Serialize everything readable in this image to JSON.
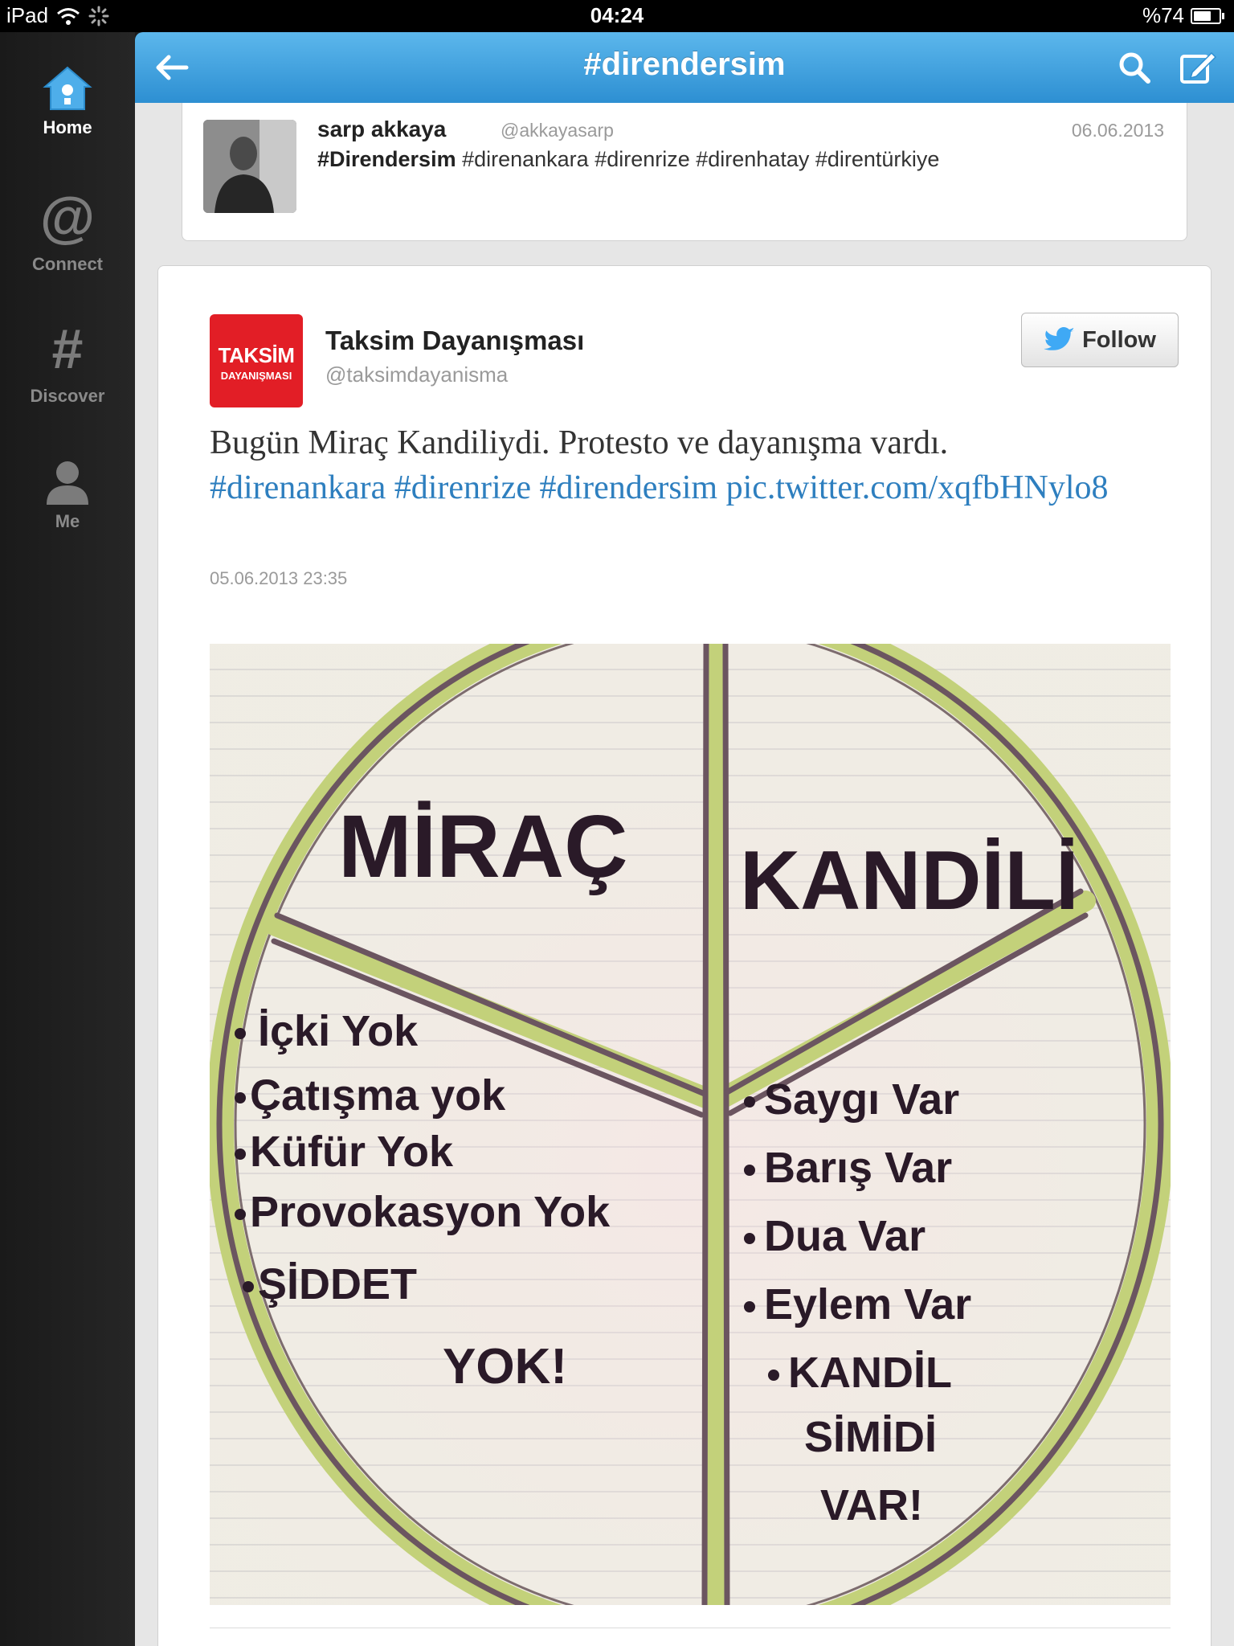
{
  "status_bar": {
    "device": "iPad",
    "time": "04:24",
    "battery": "%74",
    "battery_level": 0.74
  },
  "sidebar": {
    "items": [
      {
        "label": "Home",
        "icon": "house-icon"
      },
      {
        "label": "Connect",
        "icon": "at-icon",
        "glyph": "@"
      },
      {
        "label": "Discover",
        "icon": "hash-icon",
        "glyph": "#"
      },
      {
        "label": "Me",
        "icon": "person-icon"
      }
    ]
  },
  "header": {
    "title": "#direndersim",
    "back_icon": "back-arrow-icon",
    "search_icon": "search-icon",
    "compose_icon": "compose-icon"
  },
  "tweet_top": {
    "name": "sarp akkaya",
    "handle": "@akkayasarp",
    "date": "06.06.2013",
    "text_bold": "#Direndersim",
    "text_rest": " #direnankara #direnrize #direnhatay #direntürkiye"
  },
  "tweet_main": {
    "logo_line1": "TAKSİM",
    "logo_line2": "DAYANIŞMASI",
    "name": "Taksim Dayanışması",
    "handle": "@taksimdayanisma",
    "follow_label": "Follow",
    "text": "Bugün Miraç Kandiliydi. Protesto ve dayanışma vardı.",
    "tag1": "#direnankara",
    "tag2": "#direnrize",
    "tag3": "#direndersim",
    "link": "pic.twitter.com/xqfbHNylo8",
    "timestamp": "05.06.2013 23:35"
  },
  "photo": {
    "title_left": "MİRAÇ",
    "title_right": "KANDİLİ",
    "left_items": [
      "İçki Yok",
      "Çatışma yok",
      "Küfür Yok",
      "Provokasyon Yok",
      "ŞİDDET",
      "YOK!"
    ],
    "right_items": [
      "Saygı Var",
      "Barış Var",
      "Dua Var",
      "Eylem Var",
      "KANDİL",
      "SİMİDİ",
      "VAR!"
    ]
  }
}
